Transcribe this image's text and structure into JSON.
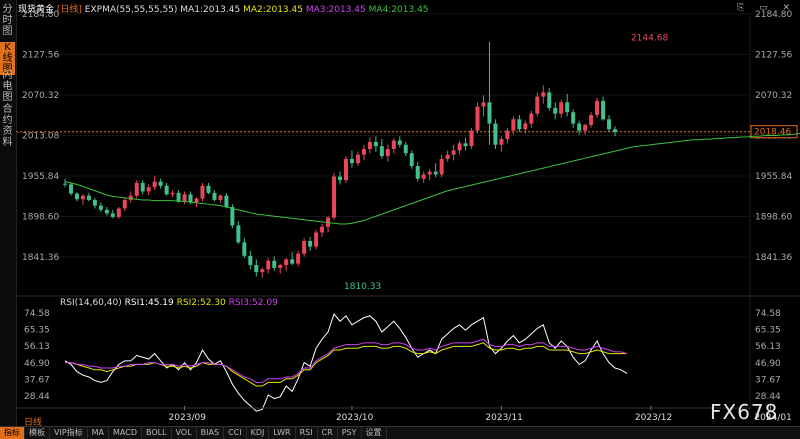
{
  "sidebar": {
    "tabs": [
      {
        "label": "分时图",
        "active": false
      },
      {
        "label": "K线图",
        "active": true
      },
      {
        "label": "闪电图",
        "active": false
      },
      {
        "label": "合约资料",
        "active": false
      }
    ]
  },
  "header": {
    "title": "现货黄金",
    "period": "[日线]",
    "ind1": "EXPMA(55,55,55,55)",
    "ma1": "MA1:2013.45",
    "ma2": "MA2:2013.45",
    "ma3": "MA3:2013.45",
    "ma4": "MA4:2013.45"
  },
  "window_controls": "⎘ ▭ ✕",
  "rsi_header": {
    "main": "RSI(14,60,40)",
    "rsi1": "RSI1:45.19",
    "rsi2": "RSI2:52.30",
    "rsi3": "RSI3:52.09"
  },
  "period_label": "日线",
  "bottom_tabs": [
    {
      "label": "指标",
      "active": true
    },
    {
      "label": "模板",
      "active": false
    },
    {
      "label": "VIP指标",
      "active": false
    },
    {
      "label": "MA",
      "active": false
    },
    {
      "label": "MACD",
      "active": false
    },
    {
      "label": "BOLL",
      "active": false
    },
    {
      "label": "VOL",
      "active": false
    },
    {
      "label": "BIAS",
      "active": false
    },
    {
      "label": "CCI",
      "active": false
    },
    {
      "label": "KDJ",
      "active": false
    },
    {
      "label": "LWR",
      "active": false
    },
    {
      "label": "RSI",
      "active": false
    },
    {
      "label": "CR",
      "active": false
    },
    {
      "label": "PSY",
      "active": false
    },
    {
      "label": "设置",
      "active": false
    }
  ],
  "watermark": "FX678",
  "colors": {
    "up": "#e8475a",
    "down": "#3fc08c",
    "ema": "#3cc23c",
    "rsi1": "#ffffff",
    "rsi2": "#e6e600",
    "rsi3": "#cc44ee",
    "accent": "#e0701a"
  },
  "chart_data": [
    {
      "type": "candlestick",
      "title": "现货黄金 日线",
      "y_ticks": [
        1841.36,
        1898.6,
        1955.84,
        2013.08,
        2070.32,
        2127.56,
        2184.8
      ],
      "ylim": [
        1800,
        2185
      ],
      "x_ticks": [
        "2023/09",
        "2023/10",
        "2023/11",
        "2023/12",
        "2024/01"
      ],
      "x_tick_index": [
        20,
        48,
        73,
        98,
        118
      ],
      "current_price": 2018.46,
      "annotations": [
        {
          "label": "2144.68",
          "value": 2144.68,
          "index": 94
        },
        {
          "label": "1810.33",
          "value": 1810.33,
          "index": 46
        }
      ],
      "series": [
        {
          "name": "EXPMA",
          "values": [
            1948,
            1946,
            1944,
            1941,
            1938,
            1935,
            1932,
            1929,
            1927,
            1926,
            1925,
            1924,
            1923,
            1922,
            1922,
            1921,
            1921,
            1921,
            1921,
            1920,
            1920,
            1919,
            1918,
            1917,
            1916,
            1915,
            1914,
            1912,
            1910,
            1908,
            1906,
            1904,
            1902,
            1901,
            1900,
            1899,
            1898,
            1897,
            1896,
            1895,
            1894,
            1893,
            1892,
            1891,
            1890,
            1889,
            1888,
            1888,
            1889,
            1891,
            1893,
            1896,
            1899,
            1902,
            1905,
            1908,
            1911,
            1914,
            1917,
            1920,
            1923,
            1926,
            1929,
            1932,
            1935,
            1937,
            1939,
            1941,
            1943,
            1945,
            1947,
            1949,
            1951,
            1953,
            1955,
            1957,
            1959,
            1961,
            1963,
            1965,
            1967,
            1969,
            1971,
            1973,
            1975,
            1977,
            1979,
            1981,
            1983,
            1985,
            1987,
            1989,
            1991,
            1993,
            1995,
            1997,
            1998,
            1999,
            2000,
            2001,
            2002,
            2003,
            2004,
            2005,
            2006,
            2007,
            2007,
            2008,
            2008,
            2009,
            2009,
            2010,
            2010,
            2011,
            2011,
            2012,
            2012,
            2013,
            2013,
            2013,
            2014,
            2014,
            2015,
            2016
          ]
        }
      ],
      "ohlc": [
        [
          1945,
          1952,
          1940,
          1944
        ],
        [
          1944,
          1946,
          1928,
          1931
        ],
        [
          1931,
          1933,
          1920,
          1923
        ],
        [
          1923,
          1930,
          1915,
          1928
        ],
        [
          1928,
          1932,
          1920,
          1922
        ],
        [
          1922,
          1925,
          1910,
          1914
        ],
        [
          1914,
          1918,
          1905,
          1908
        ],
        [
          1908,
          1912,
          1900,
          1903
        ],
        [
          1903,
          1908,
          1896,
          1898
        ],
        [
          1898,
          1912,
          1895,
          1910
        ],
        [
          1910,
          1925,
          1906,
          1922
        ],
        [
          1922,
          1934,
          1918,
          1928
        ],
        [
          1928,
          1950,
          1924,
          1946
        ],
        [
          1946,
          1950,
          1930,
          1934
        ],
        [
          1934,
          1944,
          1929,
          1940
        ],
        [
          1940,
          1956,
          1936,
          1948
        ],
        [
          1948,
          1952,
          1938,
          1942
        ],
        [
          1942,
          1946,
          1928,
          1930
        ],
        [
          1930,
          1936,
          1926,
          1932
        ],
        [
          1932,
          1936,
          1918,
          1920
        ],
        [
          1920,
          1934,
          1916,
          1930
        ],
        [
          1930,
          1934,
          1916,
          1919
        ],
        [
          1919,
          1926,
          1912,
          1924
        ],
        [
          1924,
          1946,
          1920,
          1942
        ],
        [
          1942,
          1946,
          1930,
          1932
        ],
        [
          1932,
          1936,
          1920,
          1922
        ],
        [
          1922,
          1930,
          1918,
          1928
        ],
        [
          1928,
          1932,
          1910,
          1912
        ],
        [
          1912,
          1916,
          1882,
          1886
        ],
        [
          1886,
          1892,
          1860,
          1862
        ],
        [
          1862,
          1868,
          1840,
          1843
        ],
        [
          1843,
          1850,
          1824,
          1830
        ],
        [
          1830,
          1838,
          1814,
          1820
        ],
        [
          1820,
          1826,
          1812,
          1824
        ],
        [
          1824,
          1840,
          1818,
          1836
        ],
        [
          1836,
          1842,
          1822,
          1826
        ],
        [
          1826,
          1832,
          1818,
          1830
        ],
        [
          1830,
          1840,
          1822,
          1838
        ],
        [
          1838,
          1848,
          1830,
          1832
        ],
        [
          1832,
          1850,
          1828,
          1846
        ],
        [
          1846,
          1868,
          1842,
          1864
        ],
        [
          1864,
          1870,
          1850,
          1856
        ],
        [
          1856,
          1880,
          1852,
          1876
        ],
        [
          1876,
          1888,
          1870,
          1884
        ],
        [
          1884,
          1900,
          1876,
          1897
        ],
        [
          1897,
          1960,
          1894,
          1955
        ],
        [
          1955,
          1962,
          1944,
          1950
        ],
        [
          1950,
          1984,
          1946,
          1980
        ],
        [
          1980,
          1992,
          1968,
          1974
        ],
        [
          1974,
          1990,
          1970,
          1986
        ],
        [
          1986,
          2000,
          1978,
          1994
        ],
        [
          1994,
          2010,
          1988,
          2004
        ],
        [
          2004,
          2012,
          1990,
          1998
        ],
        [
          1998,
          2008,
          1980,
          1984
        ],
        [
          1984,
          2000,
          1976,
          1994
        ],
        [
          1994,
          2009,
          1988,
          2006
        ],
        [
          2006,
          2012,
          1996,
          2000
        ],
        [
          2000,
          2004,
          1984,
          1988
        ],
        [
          1988,
          1992,
          1966,
          1970
        ],
        [
          1970,
          1976,
          1948,
          1952
        ],
        [
          1952,
          1962,
          1946,
          1958
        ],
        [
          1958,
          1966,
          1950,
          1962
        ],
        [
          1962,
          1974,
          1954,
          1958
        ],
        [
          1958,
          1986,
          1954,
          1980
        ],
        [
          1980,
          1992,
          1976,
          1986
        ],
        [
          1986,
          2000,
          1978,
          1992
        ],
        [
          1992,
          2006,
          1986,
          2002
        ],
        [
          2002,
          2010,
          1992,
          1998
        ],
        [
          1998,
          2024,
          1994,
          2020
        ],
        [
          2020,
          2060,
          2016,
          2054
        ],
        [
          2054,
          2070,
          2040,
          2060
        ],
        [
          2060,
          2146,
          2000,
          2030
        ],
        [
          2030,
          2036,
          1994,
          2000
        ],
        [
          2000,
          2012,
          1990,
          2008
        ],
        [
          2008,
          2024,
          2002,
          2020
        ],
        [
          2020,
          2040,
          2014,
          2036
        ],
        [
          2036,
          2042,
          2018,
          2022
        ],
        [
          2022,
          2034,
          2016,
          2030
        ],
        [
          2030,
          2048,
          2024,
          2044
        ],
        [
          2044,
          2074,
          2040,
          2068
        ],
        [
          2068,
          2084,
          2058,
          2074
        ],
        [
          2074,
          2080,
          2048,
          2052
        ],
        [
          2052,
          2060,
          2036,
          2044
        ],
        [
          2044,
          2064,
          2038,
          2060
        ],
        [
          2060,
          2072,
          2040,
          2046
        ],
        [
          2046,
          2050,
          2024,
          2030
        ],
        [
          2030,
          2034,
          2014,
          2020
        ],
        [
          2020,
          2030,
          2014,
          2028
        ],
        [
          2028,
          2046,
          2024,
          2042
        ],
        [
          2042,
          2066,
          2038,
          2062
        ],
        [
          2062,
          2068,
          2034,
          2036
        ],
        [
          2036,
          2042,
          2018,
          2022
        ],
        [
          2022,
          2026,
          2012,
          2018
        ]
      ]
    },
    {
      "type": "line",
      "title": "RSI(14,60,40)",
      "y_ticks": [
        28.44,
        37.67,
        46.9,
        56.13,
        65.35,
        74.58
      ],
      "ylim": [
        25,
        76
      ],
      "series": [
        {
          "name": "RSI1",
          "values": [
            48,
            46,
            42,
            40,
            39,
            37,
            36,
            37,
            42,
            46,
            48,
            48,
            51,
            50,
            49,
            52,
            48,
            44,
            46,
            43,
            47,
            43,
            47,
            54,
            49,
            46,
            48,
            42,
            35,
            30,
            26,
            23,
            20,
            21,
            29,
            27,
            28,
            34,
            31,
            38,
            47,
            45,
            55,
            60,
            64,
            74,
            70,
            73,
            68,
            70,
            72,
            73,
            70,
            64,
            67,
            70,
            66,
            61,
            55,
            50,
            52,
            54,
            52,
            60,
            63,
            66,
            68,
            65,
            68,
            70,
            72,
            56,
            52,
            55,
            59,
            62,
            58,
            60,
            63,
            66,
            68,
            58,
            55,
            59,
            56,
            50,
            46,
            48,
            54,
            59,
            52,
            47,
            44,
            43,
            41
          ]
        },
        {
          "name": "RSI2",
          "values": [
            47,
            47,
            46,
            45,
            44,
            43,
            43,
            42,
            43,
            44,
            45,
            45,
            46,
            46,
            46,
            47,
            46,
            45,
            45,
            44,
            45,
            44,
            45,
            47,
            46,
            46,
            46,
            45,
            42,
            40,
            38,
            36,
            34,
            34,
            36,
            36,
            36,
            38,
            38,
            40,
            43,
            43,
            47,
            49,
            51,
            54,
            54,
            55,
            55,
            55,
            56,
            56,
            56,
            55,
            55,
            56,
            56,
            55,
            53,
            52,
            52,
            53,
            52,
            54,
            55,
            56,
            56,
            56,
            56,
            57,
            58,
            55,
            54,
            54,
            55,
            55,
            54,
            55,
            55,
            56,
            56,
            54,
            54,
            54,
            54,
            53,
            52,
            52,
            53,
            54,
            53,
            52,
            52,
            52,
            52
          ]
        },
        {
          "name": "RSI3",
          "values": [
            47,
            47,
            46,
            46,
            45,
            45,
            44,
            44,
            44,
            45,
            45,
            46,
            46,
            46,
            47,
            47,
            46,
            46,
            46,
            45,
            46,
            45,
            46,
            47,
            47,
            46,
            46,
            45,
            43,
            41,
            39,
            38,
            36,
            36,
            38,
            38,
            38,
            39,
            39,
            41,
            44,
            44,
            48,
            50,
            52,
            55,
            56,
            57,
            57,
            57,
            58,
            58,
            58,
            57,
            57,
            58,
            58,
            57,
            55,
            54,
            54,
            55,
            54,
            56,
            57,
            58,
            58,
            58,
            58,
            59,
            60,
            57,
            56,
            56,
            57,
            57,
            56,
            57,
            57,
            58,
            58,
            56,
            56,
            56,
            56,
            55,
            54,
            54,
            55,
            56,
            55,
            54,
            53,
            53,
            52
          ]
        }
      ]
    }
  ]
}
